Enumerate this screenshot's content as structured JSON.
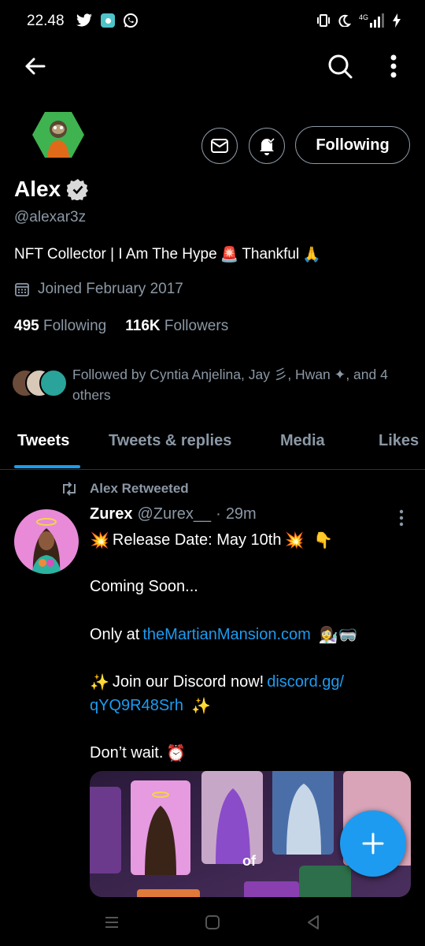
{
  "status_bar": {
    "time": "22.48",
    "network": "4G",
    "icons_left": [
      "twitter-icon",
      "app-icon",
      "whatsapp-icon"
    ],
    "icons_right": [
      "vibrate-icon",
      "dnd-moon-icon",
      "signal-icon",
      "charging-icon"
    ]
  },
  "top_bar": {
    "icons": [
      "back-arrow-icon",
      "search-icon",
      "more-vertical-icon"
    ]
  },
  "profile": {
    "name": "Alex",
    "handle": "@alexar3z",
    "bio_part1": "NFT Collector | I Am The Hype ",
    "bio_emoji1": "🚨",
    "bio_part2": "Thankful ",
    "bio_emoji2": "🙏",
    "joined": "Joined February 2017",
    "following_count": "495",
    "following_label": "Following",
    "followers_count": "116K",
    "followers_label": "Followers",
    "followed_by_text": "Followed by Cyntia Anjelina, Jay 彡, Hwan ✦, and 4 others"
  },
  "actions": {
    "following_button": "Following"
  },
  "tabs": [
    {
      "label": "Tweets",
      "active": true
    },
    {
      "label": "Tweets & replies",
      "active": false
    },
    {
      "label": "Media",
      "active": false
    },
    {
      "label": "Likes",
      "active": false
    }
  ],
  "tweet": {
    "retweet_label": "Alex Retweeted",
    "author_name": "Zurex",
    "author_handle": "@Zurex__",
    "separator": "·",
    "time": "29m",
    "line1_emoji": "💥",
    "line1_text": "Release Date: May 10th",
    "line1_emoji2": "💥",
    "line1_emoji3": "👇",
    "line2": "Coming Soon...",
    "line3_text": "Only at ",
    "line3_link": "theMartianMansion.com",
    "line3_emoji": "👩‍🔬🥽",
    "line4_emoji": "✨",
    "line4_text": "Join our Discord now! ",
    "line4_link": "discord.gg/",
    "line5_link": "qYQ9R48Srh",
    "line5_emoji": "✨",
    "line6_text": "Don’t wait. ",
    "line6_emoji": "⏰",
    "media_caption": "of"
  },
  "colors": {
    "background": "#000000",
    "accent": "#1d9bf0",
    "secondary_text": "#8b98a5",
    "border": "#2f3336"
  }
}
